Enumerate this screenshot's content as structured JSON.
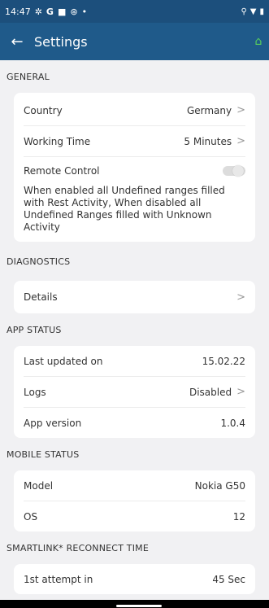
{
  "status_bar": {
    "time": "14:47",
    "icons": [
      "gear-icon",
      "g-icon",
      "square-icon",
      "circle-icon",
      "dot-icon"
    ],
    "right_icons": [
      "location-icon",
      "wifi-icon",
      "battery-icon"
    ]
  },
  "app_bar": {
    "title": "Settings",
    "back_icon": "arrow-left-icon",
    "action_icon": "android-icon"
  },
  "general": {
    "header": "GENERAL",
    "rows": [
      {
        "label": "Country",
        "value": "Germany"
      },
      {
        "label": "Working Time",
        "value": "5 Minutes"
      }
    ],
    "remote": {
      "label": "Remote Control",
      "enabled": false,
      "description": "When enabled all Undefined ranges filled with Rest Activity, When disabled all Undefined Ranges filled with Unknown Activity"
    }
  },
  "diagnostics": {
    "header": "DIAGNOSTICS",
    "rows": [
      {
        "label": "Details",
        "value": ""
      }
    ]
  },
  "app_status": {
    "header": "APP STATUS",
    "rows": [
      {
        "label": "Last updated on",
        "value": "15.02.22"
      },
      {
        "label": "Logs",
        "value": "Disabled"
      },
      {
        "label": "App version",
        "value": "1.0.4"
      }
    ]
  },
  "mobile_status": {
    "header": "MOBILE STATUS",
    "rows": [
      {
        "label": "Model",
        "value": "Nokia G50"
      },
      {
        "label": "OS",
        "value": "12"
      }
    ]
  },
  "smartlink": {
    "header": "SMARTLINK* RECONNECT TIME",
    "rows": [
      {
        "label": "1st attempt in",
        "value": "45 Sec"
      }
    ]
  },
  "colors": {
    "status_bar": "#1c4f7c",
    "app_bar": "#1f5a8a",
    "background": "#f1f1f3",
    "accent_android": "#5ad35a"
  }
}
